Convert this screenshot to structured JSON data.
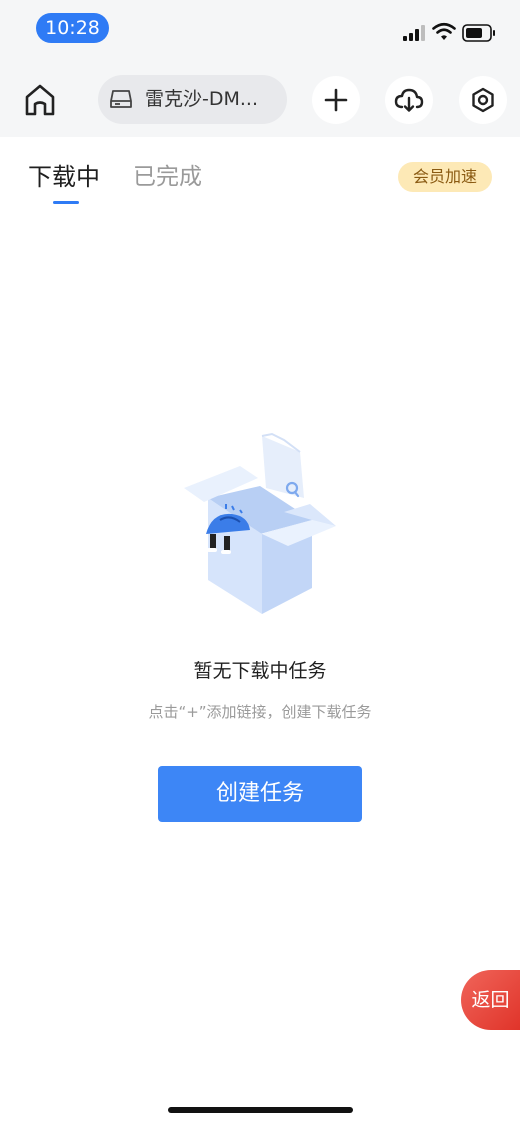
{
  "status_bar": {
    "time": "10:28"
  },
  "toolbar": {
    "device_name": "雷克沙-DM...",
    "icons": [
      "home-icon",
      "drive-icon",
      "plus-icon",
      "cloud-download-icon",
      "settings-icon"
    ]
  },
  "tabs": {
    "downloading": "下载中",
    "completed": "已完成",
    "vip_badge": "会员加速"
  },
  "empty_state": {
    "title": "暂无下载中任务",
    "description": "点击“+”添加链接，创建下载任务",
    "button": "创建任务"
  },
  "floating": {
    "back": "返回"
  },
  "colors": {
    "accent": "#3d86f6",
    "badge_bg": "#fde9b6",
    "back_button": "#e0342a"
  }
}
